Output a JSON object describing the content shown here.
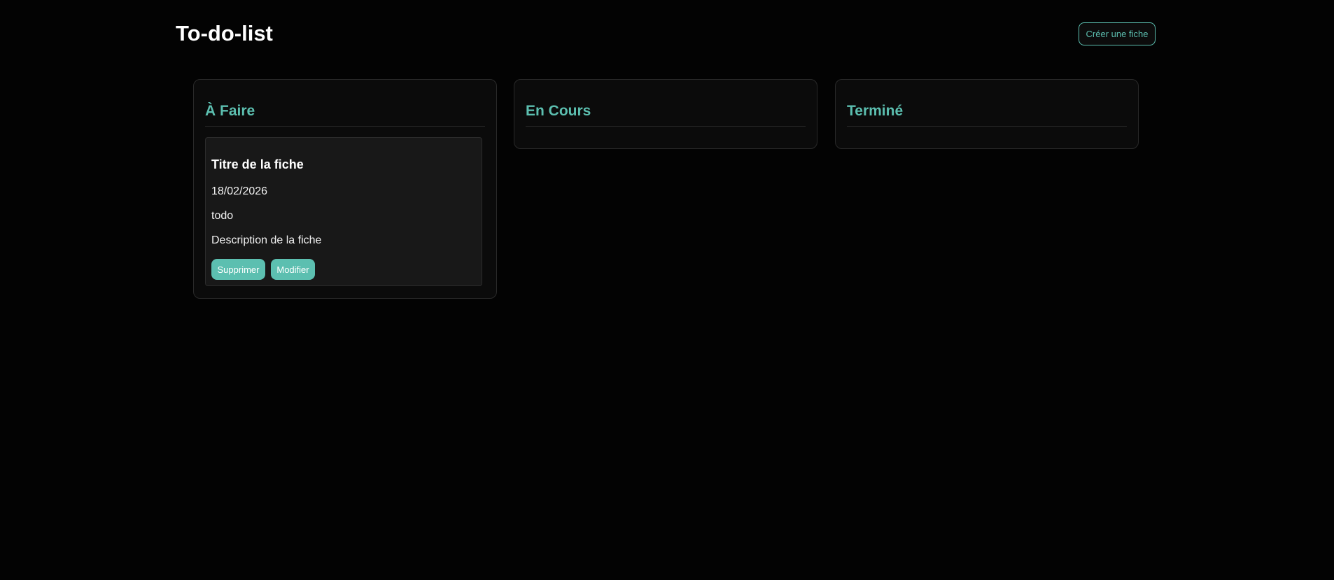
{
  "header": {
    "title": "To-do-list",
    "create_button_label": "Créer une fiche"
  },
  "columns": [
    {
      "title": "À Faire",
      "cards": [
        {
          "title": "Titre de la fiche",
          "date": "18/02/2026",
          "status": "todo",
          "description": "Description de la fiche",
          "delete_label": "Supprimer",
          "edit_label": "Modifier"
        }
      ]
    },
    {
      "title": "En Cours",
      "cards": []
    },
    {
      "title": "Terminé",
      "cards": []
    }
  ],
  "colors": {
    "accent": "#5cbfb0",
    "background": "#030303",
    "column_background": "#0b0b0b",
    "card_background": "#181818"
  }
}
